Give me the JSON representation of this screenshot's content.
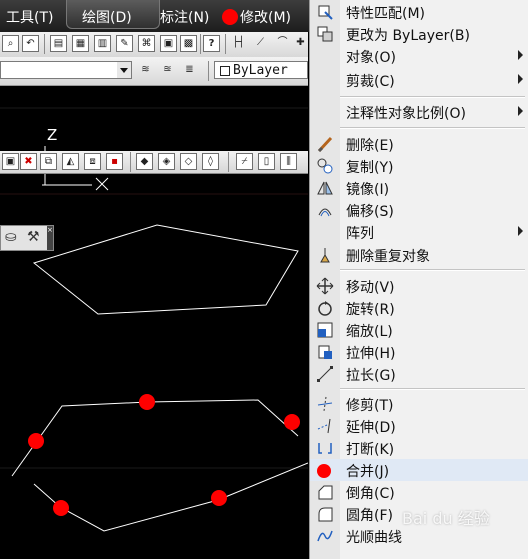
{
  "menubar": {
    "tools": "工具(T)",
    "draw": "绘图(D)",
    "dimension": "标注(N)",
    "modify": "修改(M)"
  },
  "toolbar": {
    "layer_value": "ByLayer",
    "help_label": "?"
  },
  "canvas": {
    "ucs_label": "Z"
  },
  "menu": {
    "items": [
      {
        "label": "特性匹配(M)"
      },
      {
        "label": "更改为 ByLayer(B)"
      },
      {
        "label": "对象(O)"
      },
      {
        "label": "剪裁(C)"
      },
      {
        "label": "注释性对象比例(O)"
      },
      {
        "label": "删除(E)"
      },
      {
        "label": "复制(Y)"
      },
      {
        "label": "镜像(I)"
      },
      {
        "label": "偏移(S)"
      },
      {
        "label": "阵列"
      },
      {
        "label": "删除重复对象"
      },
      {
        "label": "移动(V)"
      },
      {
        "label": "旋转(R)"
      },
      {
        "label": "缩放(L)"
      },
      {
        "label": "拉伸(H)"
      },
      {
        "label": "拉长(G)"
      },
      {
        "label": "修剪(T)"
      },
      {
        "label": "延伸(D)"
      },
      {
        "label": "打断(K)"
      },
      {
        "label": "合并(J)"
      },
      {
        "label": "倒角(C)"
      },
      {
        "label": "圆角(F)"
      },
      {
        "label": "光顺曲线"
      }
    ]
  },
  "watermark": "Bai du 经验",
  "colors": {
    "marker": "#ff0000",
    "menu_bg": "#f1f1f1",
    "highlight": "#dde8f6"
  }
}
